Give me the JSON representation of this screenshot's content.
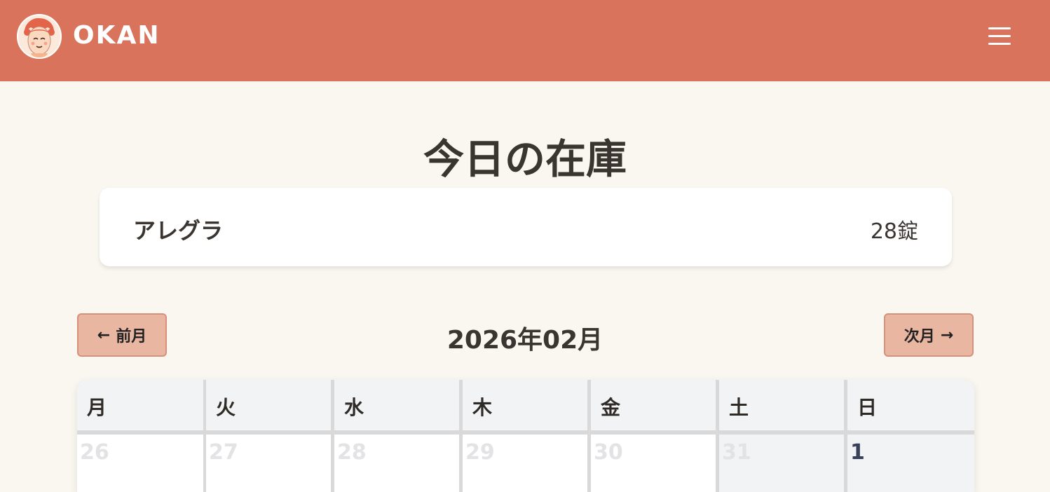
{
  "header": {
    "brand": "OKAN",
    "logo_icon": "okan-mother-face-logo",
    "menu_icon": "hamburger-menu-icon",
    "bg_color": "#d9735c"
  },
  "main": {
    "title": "今日の在庫",
    "stock": {
      "name": "アレグラ",
      "count": "28錠"
    }
  },
  "calendar": {
    "month_label": "2026年02月",
    "prev_label": "前月",
    "next_label": "次月",
    "prev_icon": "arrow-left-icon",
    "next_icon": "arrow-right-icon",
    "weekdays": [
      "月",
      "火",
      "水",
      "木",
      "金",
      "土",
      "日"
    ],
    "first_week": [
      "26",
      "27",
      "28",
      "29",
      "30",
      "31",
      "1"
    ],
    "button_color": "#e9b6a2"
  }
}
